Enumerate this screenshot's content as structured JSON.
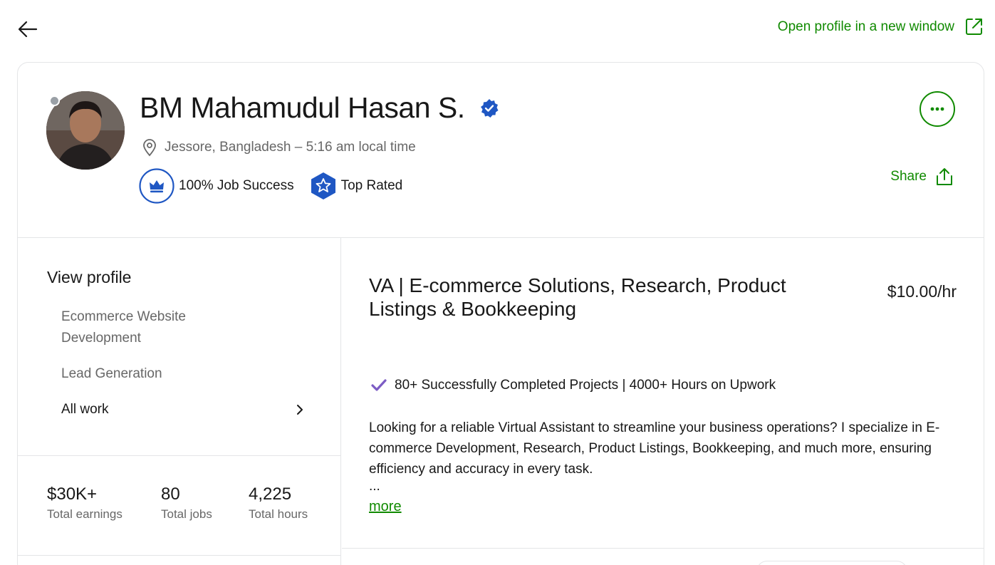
{
  "top": {
    "open_profile_label": "Open profile in a new window"
  },
  "profile": {
    "name": "BM Mahamudul Hasan S.",
    "location": "Jessore, Bangladesh – 5:16 am local time",
    "job_success": "100% Job Success",
    "top_rated": "Top Rated",
    "share_label": "Share"
  },
  "sidebar": {
    "view_profile": "View profile",
    "items": [
      {
        "label": "Ecommerce Website Development"
      },
      {
        "label": "Lead Generation"
      },
      {
        "label": "All work"
      }
    ]
  },
  "stats": [
    {
      "value": "$30K+",
      "label": "Total earnings"
    },
    {
      "value": "80",
      "label": "Total jobs"
    },
    {
      "value": "4,225",
      "label": "Total hours"
    }
  ],
  "main": {
    "title": "VA | E-commerce Solutions, Research, Product Listings & Bookkeeping",
    "rate": "$10.00/hr",
    "highlight": "80+ Successfully Completed Projects | 4000+ Hours on Upwork",
    "description": "Looking for a reliable Virtual Assistant to streamline your business operations? I specialize in E-commerce Development, Research, Product Listings, Bookkeeping, and much more, ensuring efficiency and accuracy in every task.",
    "ellipsis": "...",
    "more_label": "more"
  },
  "colors": {
    "accent_green": "#108a00",
    "verified_blue": "#1f57c3",
    "check_purple": "#7c5cc4",
    "border": "#e4e5e7"
  },
  "icons": [
    "arrow-left-icon",
    "external-link-icon",
    "verified-badge-icon",
    "location-pin-icon",
    "crown-icon",
    "star-hexagon-icon",
    "more-dots-icon",
    "share-icon",
    "chevron-right-icon",
    "check-icon"
  ]
}
